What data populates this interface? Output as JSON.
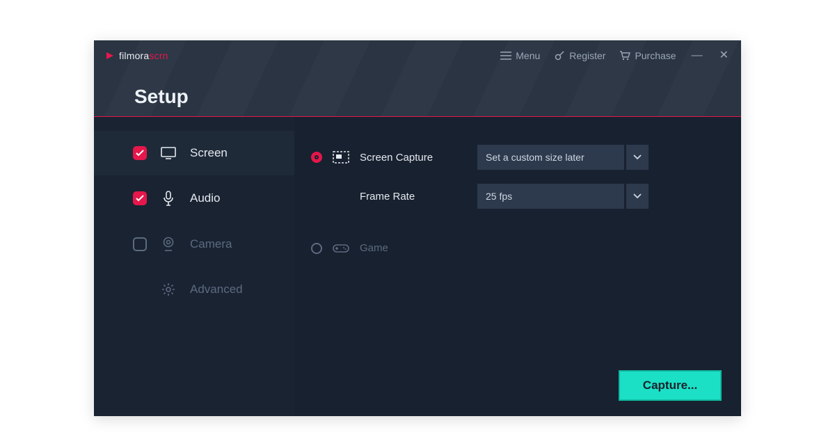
{
  "app": {
    "brand_main": "filmora",
    "brand_sub": "scrn",
    "title": "Setup"
  },
  "topbar": {
    "menu": "Menu",
    "register": "Register",
    "purchase": "Purchase"
  },
  "sidebar": {
    "items": [
      {
        "label": "Screen",
        "checked": true,
        "dim": false
      },
      {
        "label": "Audio",
        "checked": true,
        "dim": false
      },
      {
        "label": "Camera",
        "checked": false,
        "dim": true
      },
      {
        "label": "Advanced",
        "checked": null,
        "dim": true
      }
    ]
  },
  "options": {
    "screen_capture": {
      "label": "Screen Capture",
      "selected": "Set a custom size later"
    },
    "frame_rate": {
      "label": "Frame Rate",
      "selected": "25 fps"
    },
    "game": {
      "label": "Game"
    }
  },
  "actions": {
    "capture": "Capture..."
  }
}
